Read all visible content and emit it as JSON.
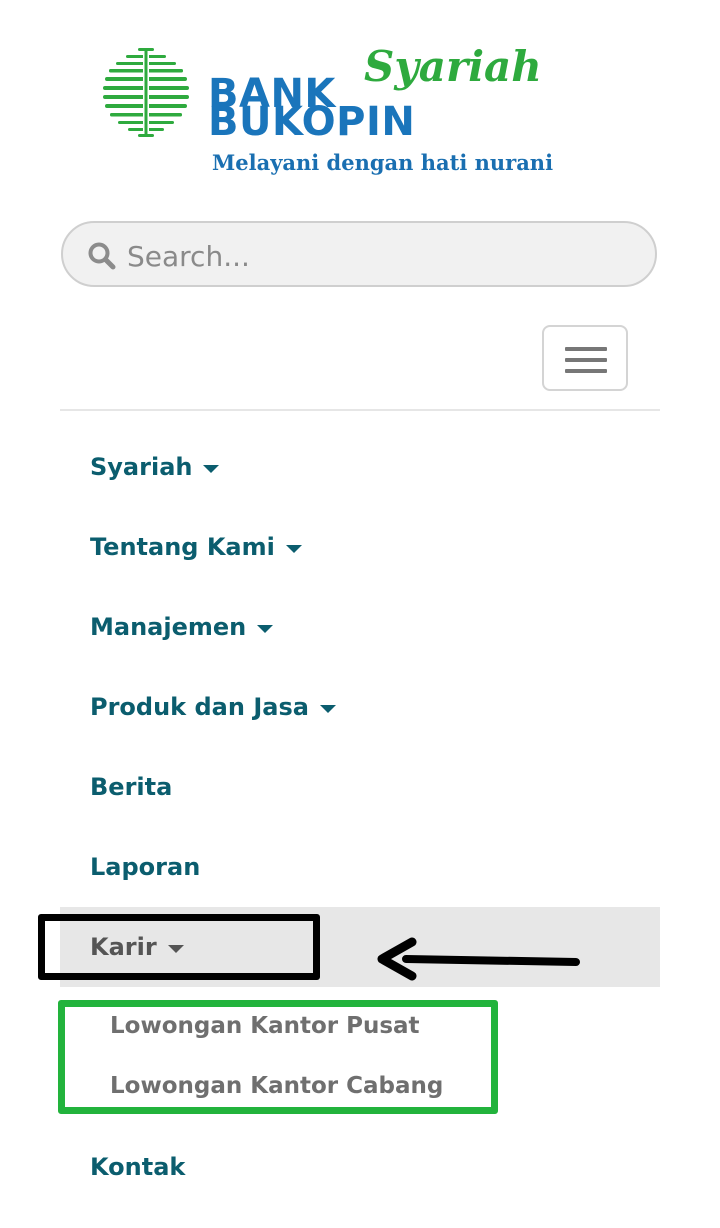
{
  "logo": {
    "brand_primary": "BANK",
    "brand_script": "Syariah",
    "brand_secondary": "BUKOPIN",
    "tagline": "Melayani dengan hati nurani",
    "icon": "bank-logo-icon",
    "colors": {
      "blue": "#1a75bb",
      "green": "#2eaa3e"
    }
  },
  "search": {
    "placeholder": "Search...",
    "value": "",
    "icon": "search-icon"
  },
  "nav_toggle": {
    "icon": "hamburger-menu-icon"
  },
  "menu": {
    "items": [
      {
        "label": "Syariah",
        "has_dropdown": true
      },
      {
        "label": "Tentang Kami",
        "has_dropdown": true
      },
      {
        "label": "Manajemen",
        "has_dropdown": true
      },
      {
        "label": "Produk dan Jasa",
        "has_dropdown": true
      },
      {
        "label": "Berita",
        "has_dropdown": false
      },
      {
        "label": "Laporan",
        "has_dropdown": false
      },
      {
        "label": "Karir",
        "has_dropdown": true,
        "active": true
      },
      {
        "label": "Kontak",
        "has_dropdown": false
      }
    ],
    "karir_submenu": [
      {
        "label": "Lowongan Kantor Pusat"
      },
      {
        "label": "Lowongan Kantor Cabang"
      }
    ]
  },
  "annotations": {
    "highlight_active_color": "#000000",
    "highlight_submenu_color": "#22b33c",
    "arrow": "left-arrow-icon"
  },
  "colors": {
    "menu_text": "#0b5d6e",
    "active_bg": "#e7e7e7",
    "submenu_text": "#6f6f6f"
  }
}
